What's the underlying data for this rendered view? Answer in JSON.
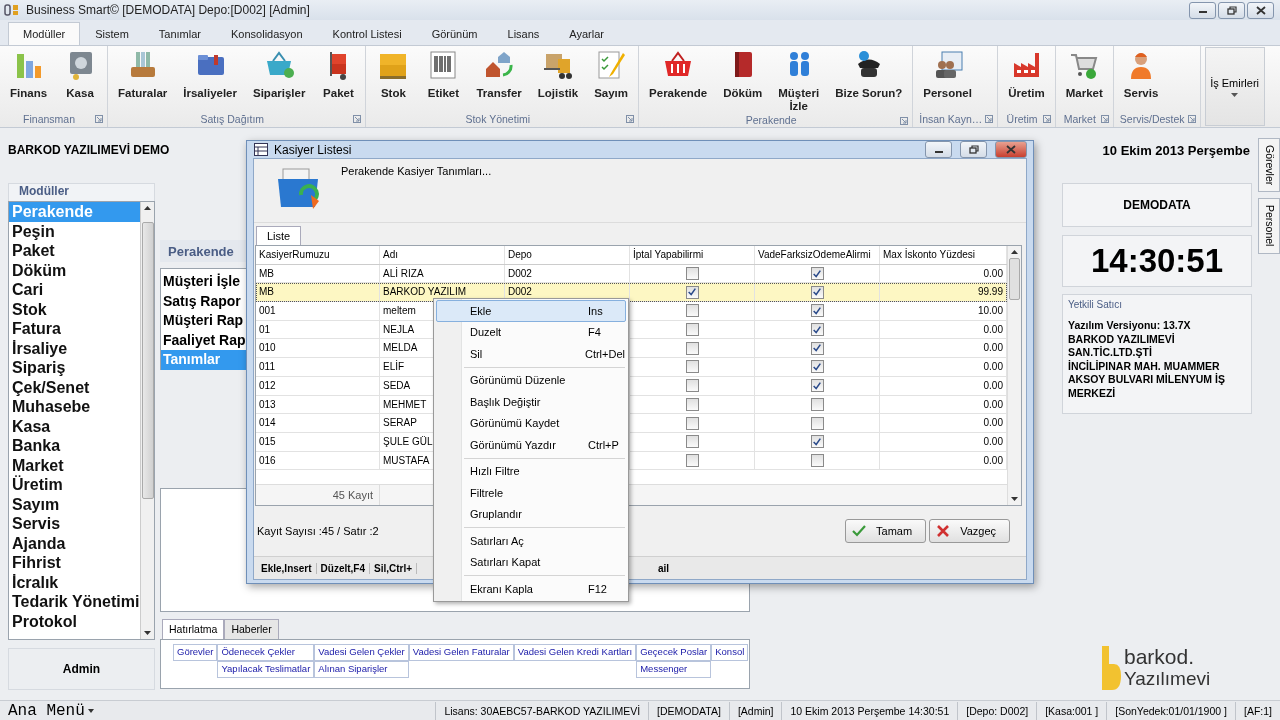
{
  "window": {
    "title": "Business Smart© [DEMODATA] Depo:[D002] [Admin]"
  },
  "ribbon_tabs": [
    {
      "label": "Modüller",
      "selected": true
    },
    {
      "label": "Sistem",
      "selected": false
    },
    {
      "label": "Tanımlar",
      "selected": false
    },
    {
      "label": "Konsolidasyon",
      "selected": false
    },
    {
      "label": "Kontrol Listesi",
      "selected": false
    },
    {
      "label": "Görünüm",
      "selected": false
    },
    {
      "label": "Lisans",
      "selected": false
    },
    {
      "label": "Ayarlar",
      "selected": false
    }
  ],
  "ribbon_groups": [
    {
      "caption": "Finansman",
      "buttons": [
        "Finans",
        "Kasa"
      ]
    },
    {
      "caption": "Satış Dağıtım",
      "buttons": [
        "Faturalar",
        "İrsaliyeler",
        "Siparişler",
        "Paket"
      ]
    },
    {
      "caption": "Stok Yönetimi",
      "buttons": [
        "Stok",
        "Etiket",
        "Transfer",
        "Lojistik",
        "Sayım"
      ]
    },
    {
      "caption": "Perakende",
      "buttons": [
        "Perakende",
        "Döküm",
        "Müşteri\nİzle",
        "Bize Sorun?"
      ]
    },
    {
      "caption": "İnsan Kayn…",
      "buttons": [
        "Personel"
      ]
    },
    {
      "caption": "Üretim",
      "buttons": [
        "Üretim"
      ]
    },
    {
      "caption": "Market",
      "buttons": [
        "Market"
      ]
    },
    {
      "caption": "Servis/Destek",
      "buttons": [
        "Servis"
      ]
    }
  ],
  "ribbon_dropdown": {
    "label": "İş Emirleri"
  },
  "company": "BARKOD YAZILIMEVİ DEMO",
  "modules": {
    "title": "Modüller",
    "items": [
      {
        "label": "Perakende",
        "selected": true
      },
      {
        "label": "Peşin",
        "selected": false
      },
      {
        "label": "Paket",
        "selected": false
      },
      {
        "label": "Döküm",
        "selected": false
      },
      {
        "label": "Cari",
        "selected": false
      },
      {
        "label": "Stok",
        "selected": false
      },
      {
        "label": "Fatura",
        "selected": false
      },
      {
        "label": "İrsaliye",
        "selected": false
      },
      {
        "label": "Sipariş",
        "selected": false
      },
      {
        "label": "Çek/Senet",
        "selected": false
      },
      {
        "label": "Muhasebe",
        "selected": false
      },
      {
        "label": "Kasa",
        "selected": false
      },
      {
        "label": "Banka",
        "selected": false
      },
      {
        "label": "Market",
        "selected": false
      },
      {
        "label": "Üretim",
        "selected": false
      },
      {
        "label": "Sayım",
        "selected": false
      },
      {
        "label": "Servis",
        "selected": false
      },
      {
        "label": "Ajanda",
        "selected": false
      },
      {
        "label": "Fihrist",
        "selected": false
      },
      {
        "label": "İcralık",
        "selected": false
      },
      {
        "label": "Tedarik Yönetimi",
        "selected": false
      },
      {
        "label": "Protokol",
        "selected": false
      }
    ]
  },
  "user": "Admin",
  "submenu": {
    "title": "Perakende",
    "items": [
      {
        "label": "Müşteri İşle",
        "selected": false
      },
      {
        "label": "Satış Rapor",
        "selected": false
      },
      {
        "label": "Müşteri Rap",
        "selected": false
      },
      {
        "label": "Faaliyet Rap",
        "selected": false
      },
      {
        "label": "Tanımlar",
        "selected": true
      }
    ]
  },
  "reminder_tabs": [
    {
      "label": "Hatırlatma",
      "selected": true
    },
    {
      "label": "Haberler",
      "selected": false
    }
  ],
  "reminder_links": [
    [
      "Görevler",
      "Ödenecek Çekler",
      "Vadesi Gelen Çekler",
      "Vadesi Gelen Faturalar",
      "Vadesi Gelen Kredi Kartları",
      "Geçecek Poslar",
      "Konsol"
    ],
    [
      "Yapılacak Teslimatlar",
      "Alınan Siparişler",
      "Messenger"
    ]
  ],
  "info": {
    "date": "10 Ekim 2013 Perşembe",
    "database": "DEMODATA",
    "clock": "14:30:51",
    "dealer_caption": "Yetkili Satıcı",
    "dealer_text": "Yazılım Versiyonu: 13.7X\nBARKOD YAZILIMEVİ\nSAN.TİC.LTD.ŞTİ\nİNCİLİPINAR MAH. MUAMMER AKSOY BULVARI MİLENYUM İŞ MERKEZİ",
    "logo": [
      "barkod.",
      "Yazılımevi"
    ]
  },
  "side_tabs": [
    "Görevler",
    "Personel"
  ],
  "dialog": {
    "title": "Kasiyer Listesi",
    "subtitle": "Perakende Kasiyer Tanımları...",
    "tabs": [
      {
        "label": "Liste",
        "selected": true
      }
    ],
    "grid": {
      "columns": [
        "KasiyerRumuzu",
        "Adı",
        "Depo",
        "İptal Yapabilirmi",
        "VadeFarksizOdemeAlirmi",
        "Max İskonto Yüzdesi"
      ],
      "rows": [
        {
          "code": "MB",
          "name": "ALİ RIZA",
          "depot": "D002",
          "can_cancel": false,
          "no_interest": true,
          "max_discount": "0.00",
          "selected": false
        },
        {
          "code": "MB",
          "name": "BARKOD YAZILIM",
          "depot": "D002",
          "can_cancel": true,
          "no_interest": true,
          "max_discount": "99.99",
          "selected": true
        },
        {
          "code": "001",
          "name": "meltem",
          "can_cancel": false,
          "no_interest": true,
          "max_discount": "10.00",
          "selected": false
        },
        {
          "code": "01",
          "name": "NEJLA",
          "can_cancel": false,
          "no_interest": true,
          "max_discount": "0.00",
          "selected": false
        },
        {
          "code": "010",
          "name": "MELDA",
          "can_cancel": false,
          "no_interest": true,
          "max_discount": "0.00",
          "selected": false
        },
        {
          "code": "011",
          "name": "ELİF",
          "can_cancel": false,
          "no_interest": true,
          "max_discount": "0.00",
          "selected": false
        },
        {
          "code": "012",
          "name": "SEDA",
          "can_cancel": false,
          "no_interest": true,
          "max_discount": "0.00",
          "selected": false
        },
        {
          "code": "013",
          "name": "MEHMET",
          "can_cancel": false,
          "no_interest": false,
          "max_discount": "0.00",
          "selected": false
        },
        {
          "code": "014",
          "name": "SERAP",
          "can_cancel": false,
          "no_interest": false,
          "max_discount": "0.00",
          "selected": false
        },
        {
          "code": "015",
          "name": "ŞULE GÜL",
          "can_cancel": false,
          "no_interest": true,
          "max_discount": "0.00",
          "selected": false
        },
        {
          "code": "016",
          "name": "MUSTAFA",
          "can_cancel": false,
          "no_interest": false,
          "max_discount": "0.00",
          "selected": false
        }
      ],
      "footer": "45 Kayıt"
    },
    "record_info": "Kayıt Sayısı :45 / Satır :2",
    "buttons": [
      {
        "label": "Tamam",
        "kind": "ok"
      },
      {
        "label": "Vazgeç",
        "kind": "cancel"
      }
    ],
    "shortcuts": [
      "Ekle,Insert",
      "Düzelt,F4",
      "Sil,Ctrl+"
    ],
    "shortcuts_tail": "ail"
  },
  "context_menu": {
    "groups": [
      [
        {
          "label": "Ekle",
          "shortcut": "Ins",
          "selected": true
        },
        {
          "label": "Duzelt",
          "shortcut": "F4",
          "selected": false
        },
        {
          "label": "Sil",
          "shortcut": "Ctrl+Del",
          "selected": false
        }
      ],
      [
        {
          "label": "Görünümü Düzenle",
          "selected": false
        },
        {
          "label": "Başlık Değiştir",
          "selected": false
        },
        {
          "label": "Görünümü Kaydet",
          "selected": false
        },
        {
          "label": "Görünümü Yazdır",
          "shortcut": "Ctrl+P",
          "selected": false
        }
      ],
      [
        {
          "label": "Hızlı Filtre",
          "selected": false
        },
        {
          "label": "Filtrele",
          "selected": false
        },
        {
          "label": "Gruplandır",
          "selected": false
        }
      ],
      [
        {
          "label": "Satırları Aç",
          "selected": false
        },
        {
          "label": "Satırları Kapat",
          "selected": false
        }
      ],
      [
        {
          "label": "Ekranı Kapla",
          "shortcut": "F12",
          "selected": false
        }
      ]
    ]
  },
  "status_bar": {
    "menu": "Ana Menü",
    "fields": [
      "Lisans: 30AEBC57-BARKOD YAZILIMEVİ",
      "[DEMODATA]",
      "[Admin]",
      "10 Ekim 2013 Perşembe 14:30:51",
      "[Depo: D002]",
      "[Kasa:001 ]",
      "[SonYedek:01/01/1900 ]",
      "[AF:1]"
    ]
  }
}
